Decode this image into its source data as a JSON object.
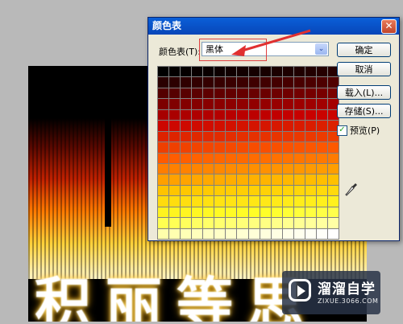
{
  "dialog": {
    "title": "颜色表",
    "close_symbol": "✕",
    "table_label": "颜色表(T):",
    "table_value": "黑体",
    "dropdown_arrow": "⌄",
    "buttons": {
      "ok": "确定",
      "cancel": "取消",
      "load": "载入(L)...",
      "save": "存储(S)..."
    },
    "preview": {
      "label": "预览(P)",
      "checked": true,
      "check_mark": "✓"
    },
    "icons": {
      "eyedropper": "eyedropper-icon",
      "close": "close-icon"
    }
  },
  "canvas": {
    "text": "积丽等思"
  },
  "watermark": {
    "name": "溜溜自学",
    "url": "ZIXUE.3066.COM"
  },
  "colors": {
    "annotation_red": "#e03030",
    "title_blue": "#0a5fd8",
    "dialog_bg": "#ece9d8"
  }
}
